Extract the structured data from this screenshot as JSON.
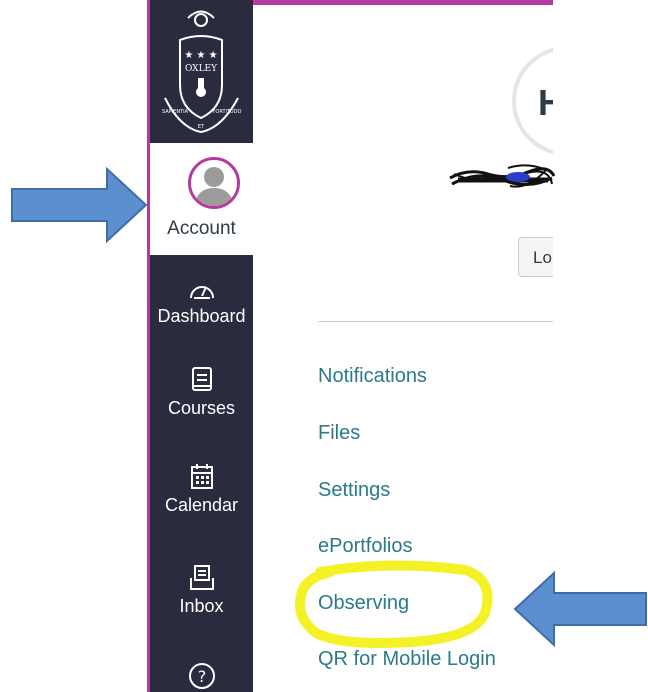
{
  "sidebar": {
    "account_label": "Account",
    "items": [
      {
        "label": "Dashboard",
        "icon": "dashboard-icon"
      },
      {
        "label": "Courses",
        "icon": "courses-icon"
      },
      {
        "label": "Calendar",
        "icon": "calendar-icon"
      },
      {
        "label": "Inbox",
        "icon": "inbox-icon"
      },
      {
        "label": "",
        "icon": "help-icon"
      }
    ],
    "logo": {
      "motto_left": "SAPIENTIA",
      "motto_right": "FORTITUDO",
      "center": "OXLEY",
      "small": "ET"
    }
  },
  "profile": {
    "initial": "H",
    "login_button_label": "Lo"
  },
  "menu": {
    "links": [
      "Notifications",
      "Files",
      "Settings",
      "ePortfolios",
      "Observing",
      "QR for Mobile Login"
    ]
  },
  "colors": {
    "sidebar_bg": "#2b2b3f",
    "accent": "#b53a9e",
    "link": "#2a7a8c",
    "arrow_fill": "#5b8fd0",
    "highlight": "#f4f226"
  }
}
